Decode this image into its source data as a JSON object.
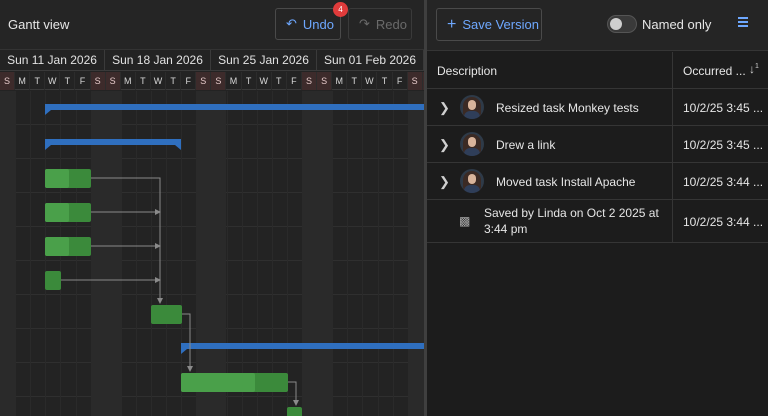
{
  "gantt": {
    "title": "Gantt view",
    "undo_label": "Undo",
    "undo_badge": "4",
    "redo_label": "Redo",
    "weeks": [
      "Sun 11 Jan 2026",
      "Sun 18 Jan 2026",
      "Sun 25 Jan 2026",
      "Sun 01 Feb 2026"
    ],
    "day_letters": [
      "S",
      "M",
      "T",
      "W",
      "T",
      "F",
      "S",
      "S",
      "M",
      "T",
      "W",
      "T",
      "F",
      "S",
      "S",
      "M",
      "T",
      "W",
      "T",
      "F",
      "S",
      "S",
      "M",
      "T",
      "W",
      "T",
      "F",
      "S",
      "S"
    ],
    "colors": {
      "summary_bar": "#2f6fbf",
      "task_bar": "#3b8a3b",
      "task_progress": "#4aa04a",
      "link": "#8a8a8a",
      "weekend": "#3d2b2b"
    }
  },
  "versions": {
    "save_version_label": "Save Version",
    "named_only_label": "Named only",
    "named_only_checked": false,
    "columns": {
      "description": "Description",
      "occurred": "Occurred ..."
    },
    "rows": [
      {
        "description": "Resized task Monkey tests",
        "occurred": "10/2/25 3:45 ..."
      },
      {
        "description": "Drew a link",
        "occurred": "10/2/25 3:45 ..."
      },
      {
        "description": "Moved task Install Apache",
        "occurred": "10/2/25 3:44 ..."
      }
    ],
    "saved_row": {
      "description": "Saved by Linda on Oct 2 2025 at 3:44 pm",
      "occurred": "10/2/25 3:44 ..."
    }
  }
}
